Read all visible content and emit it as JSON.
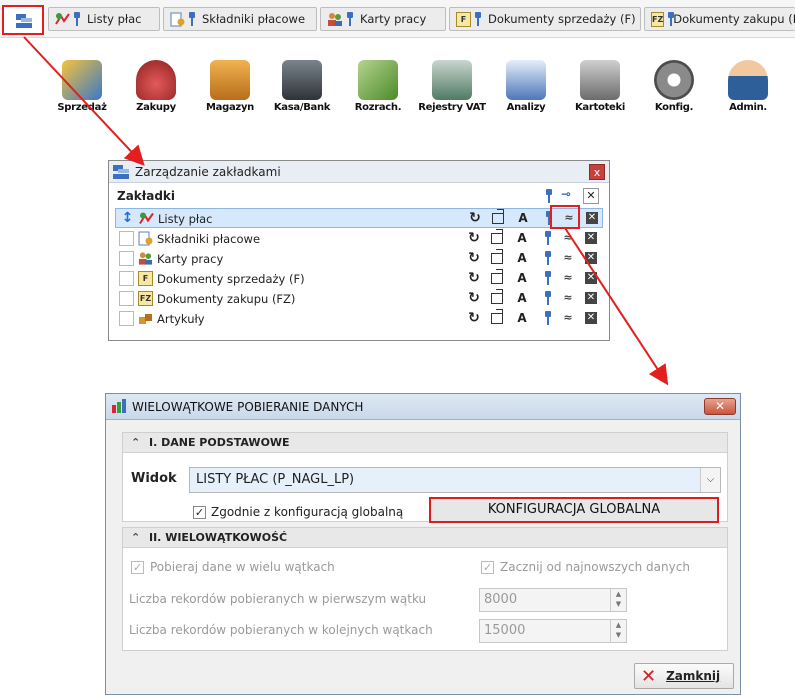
{
  "tabs": [
    {
      "label": "Listy płac"
    },
    {
      "label": "Składniki płacowe"
    },
    {
      "label": "Karty pracy"
    },
    {
      "label": "Dokumenty sprzedaży (F)",
      "badge": "F"
    },
    {
      "label": "Dokumenty zakupu (FZ",
      "badge": "FZ"
    }
  ],
  "modules": [
    {
      "label": "Sprzedaż",
      "color": "#3978c9"
    },
    {
      "label": "Zakupy",
      "color": "#c03a3a"
    },
    {
      "label": "Magazyn",
      "color": "#d8952b"
    },
    {
      "label": "Kasa/Bank",
      "color": "#555c63"
    },
    {
      "label": "Rozrach.",
      "color": "#5d9b3c"
    },
    {
      "label": "Rejestry VAT",
      "color": "#5d8a6c"
    },
    {
      "label": "Analizy",
      "color": "#4d77b8"
    },
    {
      "label": "Kartoteki",
      "color": "#7b7b7b"
    },
    {
      "label": "Konfig.",
      "color": "#6a6a6a"
    },
    {
      "label": "Admin.",
      "color": "#3a6ea8"
    }
  ],
  "bookmarks_dialog": {
    "title": "Zarządzanie zakładkami",
    "close": "x",
    "header": "Zakładki",
    "rows": [
      {
        "label": "Listy płac"
      },
      {
        "label": "Składniki płacowe"
      },
      {
        "label": "Karty pracy"
      },
      {
        "label": "Dokumenty sprzedaży (F)",
        "badge": "F"
      },
      {
        "label": "Dokumenty zakupu (FZ)",
        "badge": "FZ"
      },
      {
        "label": "Artykuły"
      }
    ]
  },
  "main_dialog": {
    "title": "WIELOWĄTKOWE POBIERANIE DANYCH",
    "close": "✕",
    "section1": {
      "title": "I. DANE PODSTAWOWE",
      "view_label": "Widok",
      "view_value": "LISTY PŁAC (P_NAGL_LP)",
      "global_checkbox": "Zgodnie z konfiguracją globalną",
      "global_button": "KONFIGURACJA GLOBALNA"
    },
    "section2": {
      "title": "II. WIELOWĄTKOWOŚĆ",
      "multi_thread": "Pobieraj dane w wielu wątkach",
      "newest_first": "Zacznij od najnowszych danych",
      "first_thread_label": "Liczba rekordów pobieranych w pierwszym wątku",
      "first_thread_value": "8000",
      "next_threads_label": "Liczba rekordów pobieranych w kolejnych wątkach",
      "next_threads_value": "15000"
    },
    "close_button": "Zamknij"
  },
  "colors": {
    "highlight": "#e21e1e"
  }
}
